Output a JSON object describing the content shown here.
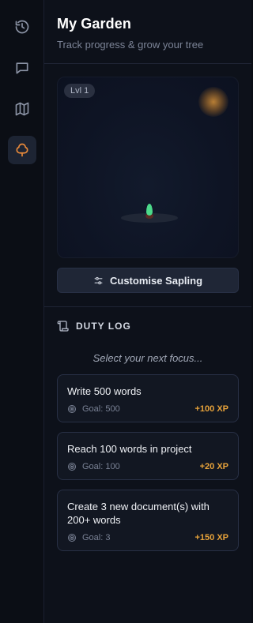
{
  "rail": {
    "items": [
      {
        "icon": "history-icon",
        "active": false
      },
      {
        "icon": "chat-icon",
        "active": false
      },
      {
        "icon": "map-icon",
        "active": false
      },
      {
        "icon": "tree-icon",
        "active": true
      }
    ]
  },
  "header": {
    "title": "My Garden",
    "subtitle": "Track progress & grow your tree"
  },
  "garden": {
    "level_badge": "Lvl 1",
    "customise_label": "Customise Sapling"
  },
  "duty": {
    "title": "DUTY LOG",
    "hint": "Select your next focus...",
    "tasks": [
      {
        "title": "Write 500 words",
        "goal": "Goal: 500",
        "xp": "+100 XP"
      },
      {
        "title": "Reach 100 words in project",
        "goal": "Goal: 100",
        "xp": "+20 XP"
      },
      {
        "title": "Create 3 new document(s) with 200+ words",
        "goal": "Goal: 3",
        "xp": "+150 XP"
      }
    ]
  },
  "colors": {
    "accent": "#e8893a",
    "xp": "#e8a33a",
    "sprout": "#4cd98a"
  }
}
